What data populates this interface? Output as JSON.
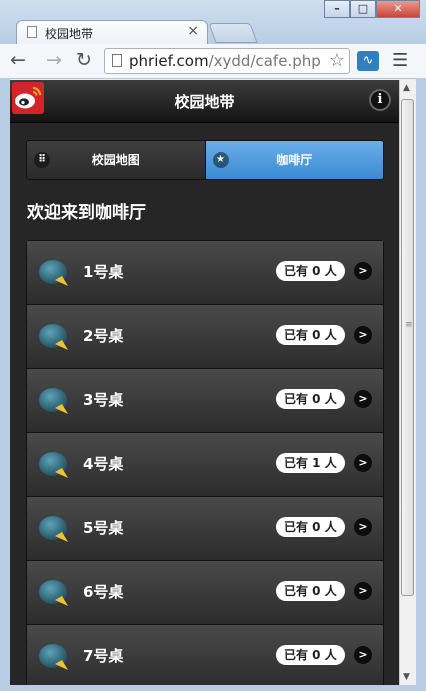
{
  "browser": {
    "tab_title": "校园地带",
    "tab_close": "×",
    "url_host": "phrief.com",
    "url_path": "/xydd/cafe.php",
    "window_buttons": {
      "minimize": "–",
      "maximize": "□",
      "close": "✕"
    }
  },
  "header": {
    "title": "校园地带",
    "info_label": "i"
  },
  "nav": {
    "tabs": [
      {
        "label": "校园地图",
        "icon": "grid-icon",
        "active": false
      },
      {
        "label": "咖啡厅",
        "icon": "star-icon",
        "active": true
      }
    ]
  },
  "main": {
    "welcome": "欢迎来到咖啡厅",
    "tables": [
      {
        "name": "1号桌",
        "count": "已有 0 人"
      },
      {
        "name": "2号桌",
        "count": "已有 0 人"
      },
      {
        "name": "3号桌",
        "count": "已有 0 人"
      },
      {
        "name": "4号桌",
        "count": "已有 1 人"
      },
      {
        "name": "5号桌",
        "count": "已有 0 人"
      },
      {
        "name": "6号桌",
        "count": "已有 0 人"
      },
      {
        "name": "7号桌",
        "count": "已有 0 人"
      }
    ]
  },
  "colors": {
    "active_tab": "#4a9ae0",
    "page_background": "#262626",
    "brand_red": "#d4242b"
  }
}
